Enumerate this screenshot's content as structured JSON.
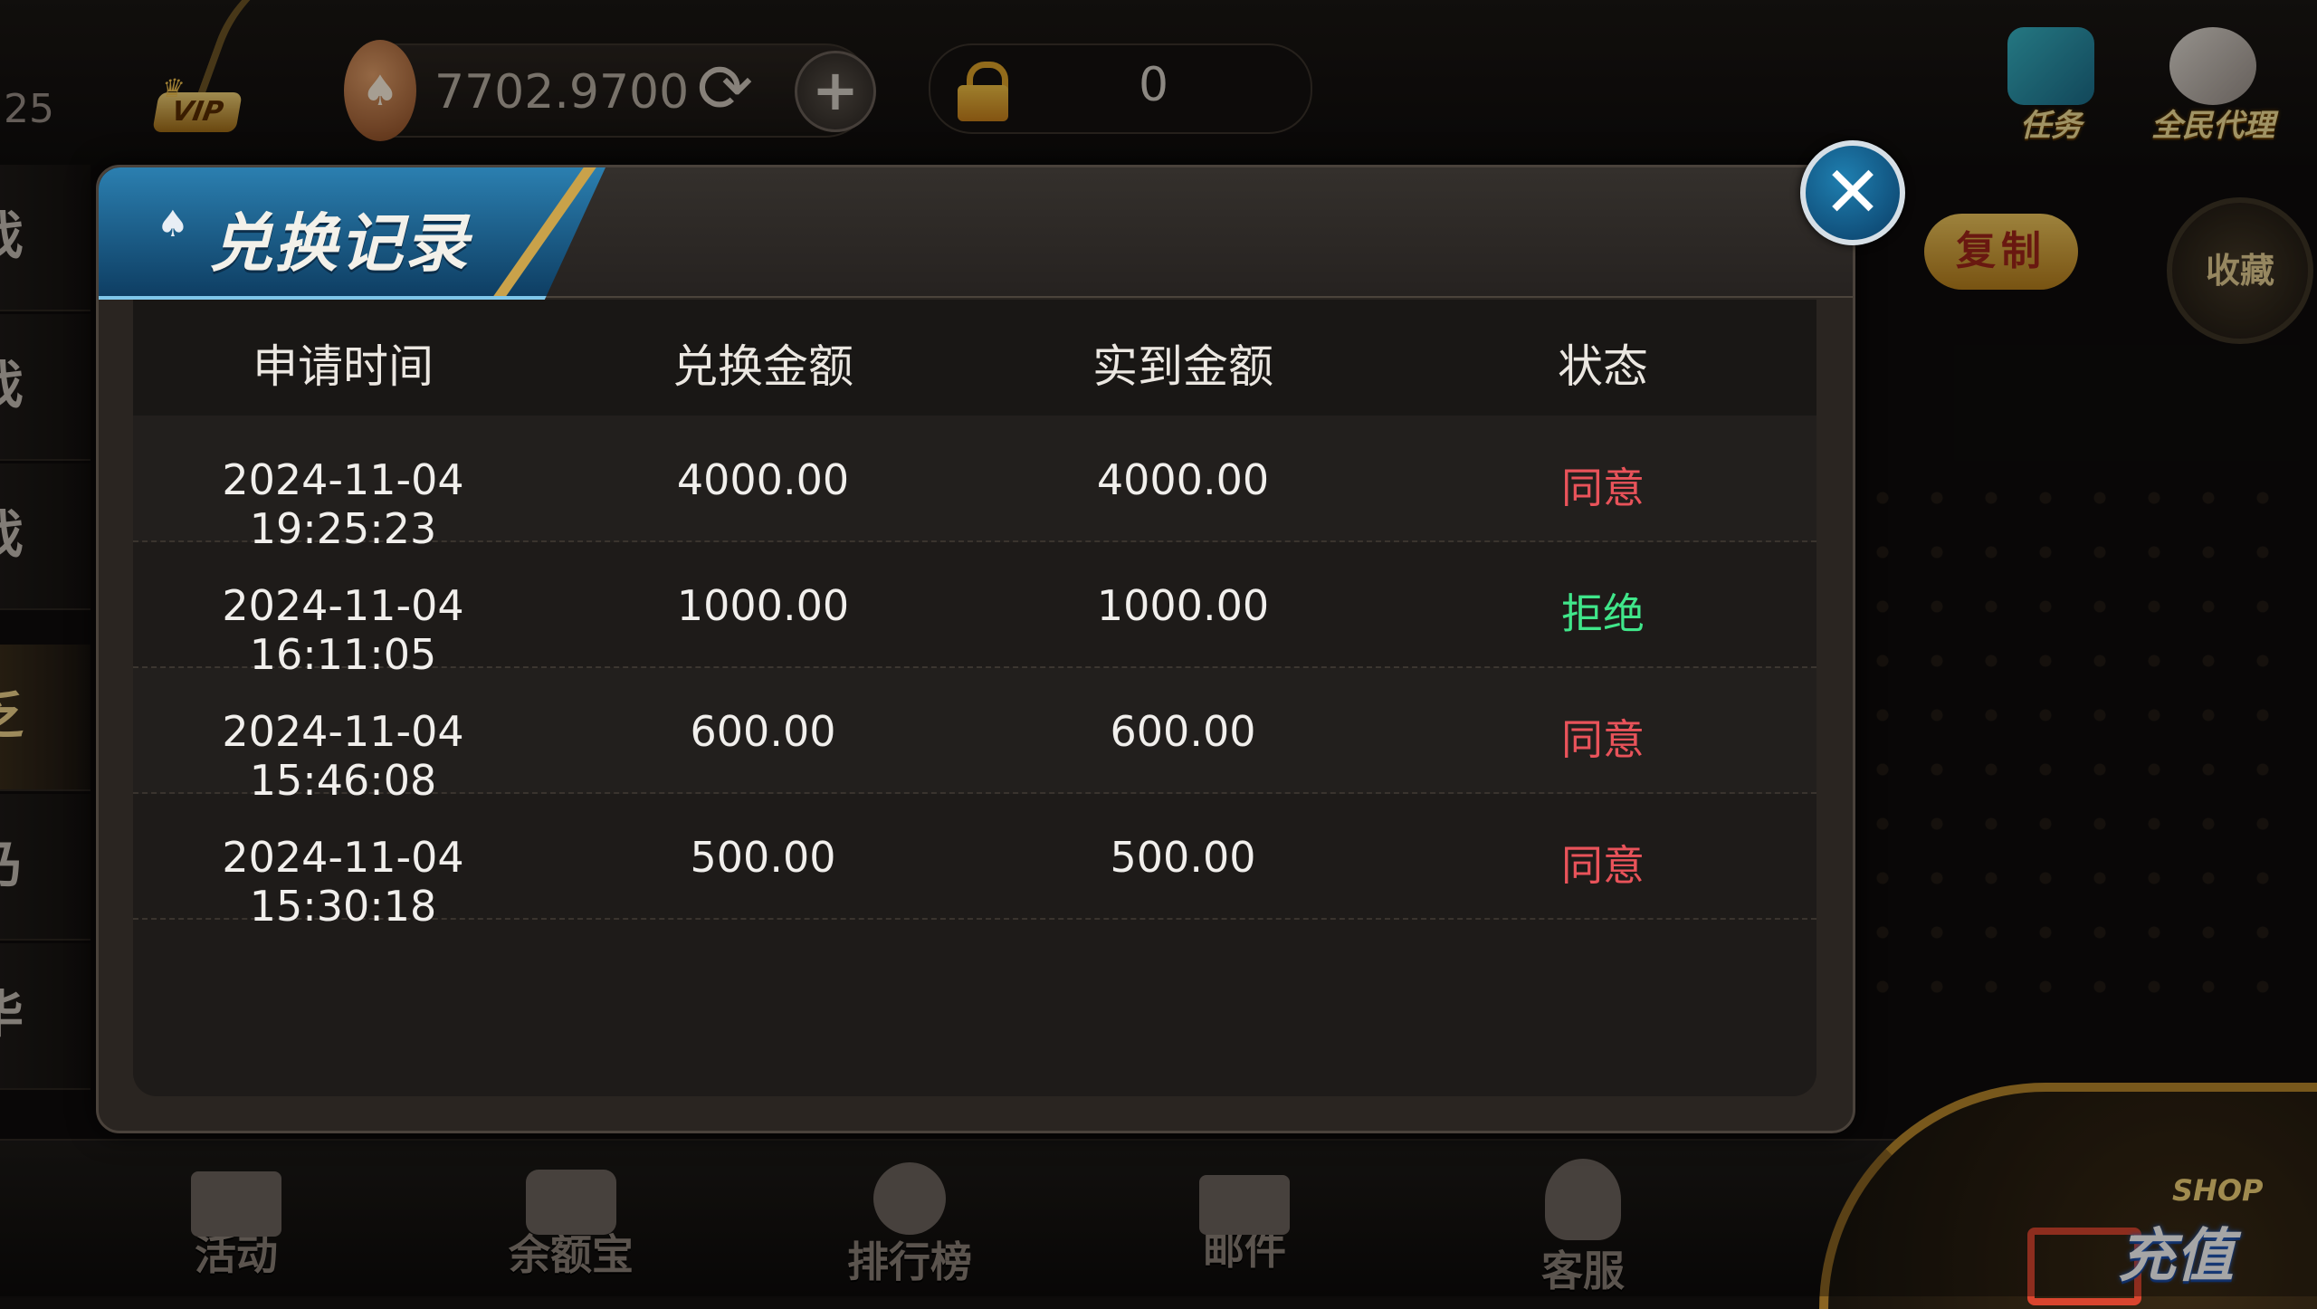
{
  "topbar": {
    "user_id_partial": "25",
    "vip_label": "VIP",
    "coin_amount": "7702.9700",
    "safe_value": "0",
    "task_label": "任务",
    "agent_label": "全民代理"
  },
  "background": {
    "copy_label": "复制",
    "favorite_label": "收藏",
    "side_tabs": [
      "戏",
      "戏",
      "戏",
      "乏",
      "乃",
      "毕"
    ]
  },
  "modal": {
    "title": "兑换记录",
    "columns": [
      "申请时间",
      "兑换金额",
      "实到金额",
      "状态"
    ],
    "rows": [
      {
        "time": "2024-11-04 19:25:23",
        "amount": "4000.00",
        "received": "4000.00",
        "status": "同意"
      },
      {
        "time": "2024-11-04 16:11:05",
        "amount": "1000.00",
        "received": "1000.00",
        "status": "拒绝"
      },
      {
        "time": "2024-11-04 15:46:08",
        "amount": "600.00",
        "received": "600.00",
        "status": "同意"
      },
      {
        "time": "2024-11-04 15:30:18",
        "amount": "500.00",
        "received": "500.00",
        "status": "同意"
      }
    ]
  },
  "bottom_nav": {
    "activity": "活动",
    "balance": "余额宝",
    "rank": "排行榜",
    "mail": "邮件",
    "service": "客服",
    "shop_tag": "SHOP",
    "shop_label": "充值"
  },
  "colors": {
    "approved": "#e9535a",
    "rejected": "#40e68a",
    "modal_title_bg": "#1f6f9f"
  }
}
